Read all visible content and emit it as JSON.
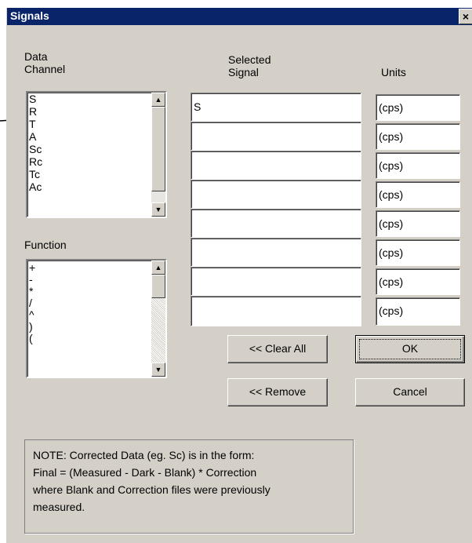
{
  "window": {
    "title": "Signals",
    "close_glyph": "×"
  },
  "labels": {
    "data_channel": "Data\nChannel",
    "selected_signal": "Selected\nSignal",
    "units": "Units",
    "function": "Function"
  },
  "data_channel_list": [
    "S",
    "R",
    "T",
    "A",
    "Sc",
    "Rc",
    "Tc",
    "Ac"
  ],
  "function_list": [
    "+",
    "-",
    "*",
    "/",
    "^",
    ")",
    "("
  ],
  "selected_signals": [
    "S",
    "",
    "",
    "",
    "",
    "",
    "",
    ""
  ],
  "units": [
    "(cps)",
    "(cps)",
    "(cps)",
    "(cps)",
    "(cps)",
    "(cps)",
    "(cps)",
    "(cps)"
  ],
  "buttons": {
    "clear_all": "<< Clear All",
    "ok": "OK",
    "remove": "<< Remove",
    "cancel": "Cancel"
  },
  "note": "NOTE: Corrected Data (eg. Sc) is in the form:\nFinal = (Measured - Dark - Blank) * Correction\nwhere Blank and Correction files were previously\nmeasured.",
  "icons": {
    "scroll_up": "up-arrow-icon",
    "scroll_down": "down-arrow-icon",
    "annotation": "pointer-arrow"
  }
}
